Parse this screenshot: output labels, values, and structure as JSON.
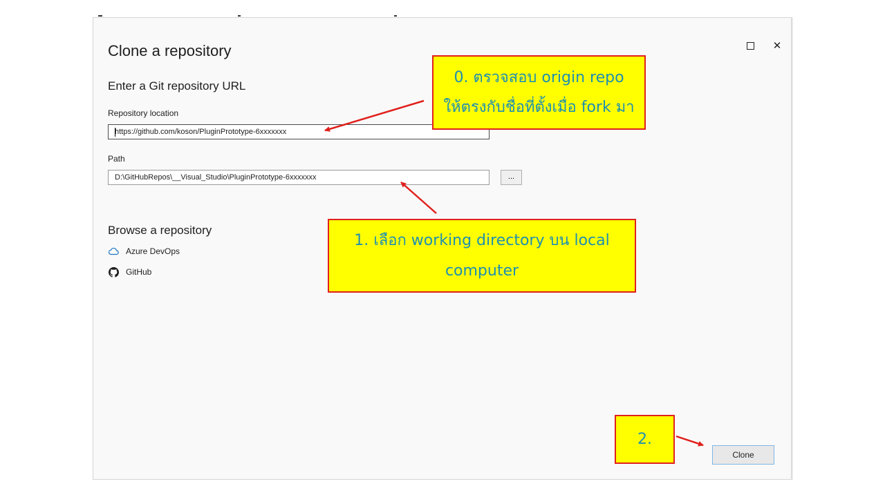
{
  "window": {
    "title": "Clone a repository",
    "maximize_icon": "maximize-icon",
    "close_icon": "close-icon"
  },
  "url_section": {
    "heading": "Enter a Git repository URL",
    "location_label": "Repository location",
    "location_value": "https://github.com/koson/PluginPrototype-6xxxxxxx",
    "path_label": "Path",
    "path_value": "D:\\GitHubRepos\\__Visual_Studio\\PluginPrototype-6xxxxxxx",
    "browse_label": "..."
  },
  "browse_section": {
    "heading": "Browse a repository",
    "providers": [
      {
        "label": "Azure DevOps",
        "icon": "cloud-icon"
      },
      {
        "label": "GitHub",
        "icon": "github-icon"
      }
    ]
  },
  "footer": {
    "clone_label": "Clone"
  },
  "annotations": {
    "callout0_line1": "0. ตรวจสอบ  origin repo",
    "callout0_line2": "ให้ตรงกับชื่อที่ตั้งเมื่อ fork มา",
    "callout1_line1": "1. เลือก working directory บน local",
    "callout1_line2": "computer",
    "callout2": "2.",
    "callout_fill": "#ffff00",
    "callout_border": "#e0201c",
    "callout_text_color": "#1f8fb0",
    "arrow_color": "#e0201c"
  }
}
